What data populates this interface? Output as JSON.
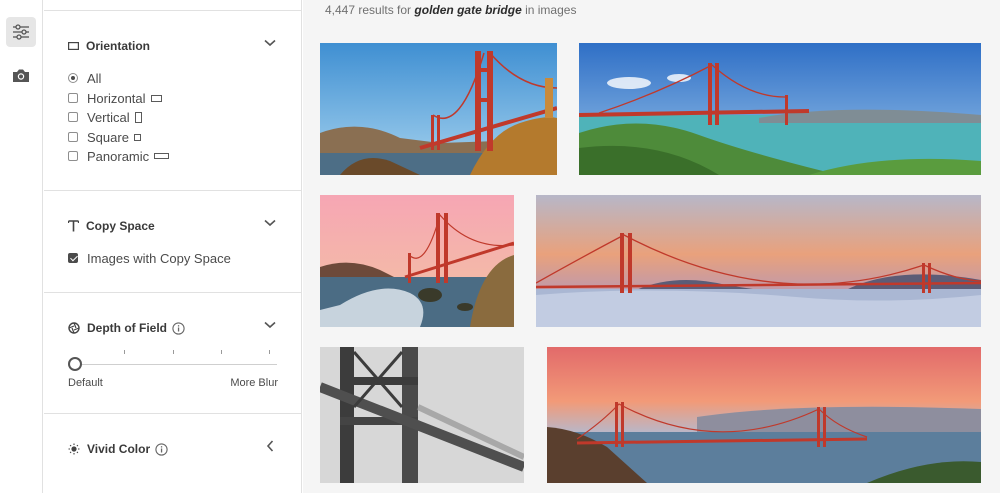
{
  "rail": {
    "items": [
      {
        "name": "filters-icon",
        "active": true
      },
      {
        "name": "camera-icon",
        "active": false
      }
    ]
  },
  "filters": {
    "orientation": {
      "title": "Orientation",
      "options": [
        {
          "label": "All",
          "selected": true
        },
        {
          "label": "Horizontal",
          "selected": false
        },
        {
          "label": "Vertical",
          "selected": false
        },
        {
          "label": "Square",
          "selected": false
        },
        {
          "label": "Panoramic",
          "selected": false
        }
      ]
    },
    "copy_space": {
      "title": "Copy Space",
      "option_label": "Images with Copy Space",
      "checked": true
    },
    "depth_of_field": {
      "title": "Depth of Field",
      "min_label": "Default",
      "max_label": "More Blur",
      "value": 0
    },
    "vivid_color": {
      "title": "Vivid Color"
    }
  },
  "results": {
    "count": "4,447",
    "text_mid": "results for",
    "query": "golden gate bridge",
    "text_end": "in images"
  },
  "images": [
    {
      "name": "image-1",
      "alt": "Golden Gate Bridge tower at sunset over rocks"
    },
    {
      "name": "image-2",
      "alt": "Golden Gate Bridge from green headlands"
    },
    {
      "name": "image-3",
      "alt": "Golden Gate Bridge at dusk with waves"
    },
    {
      "name": "image-4",
      "alt": "Golden Gate Bridge above fog"
    },
    {
      "name": "image-5",
      "alt": "Golden Gate Bridge in fog"
    },
    {
      "name": "image-6",
      "alt": "Golden Gate Bridge panorama with city skyline"
    }
  ],
  "colors": {
    "bridge": "#c0392b",
    "panel_border": "#e1e1e1",
    "main_bg": "#f5f5f5"
  }
}
